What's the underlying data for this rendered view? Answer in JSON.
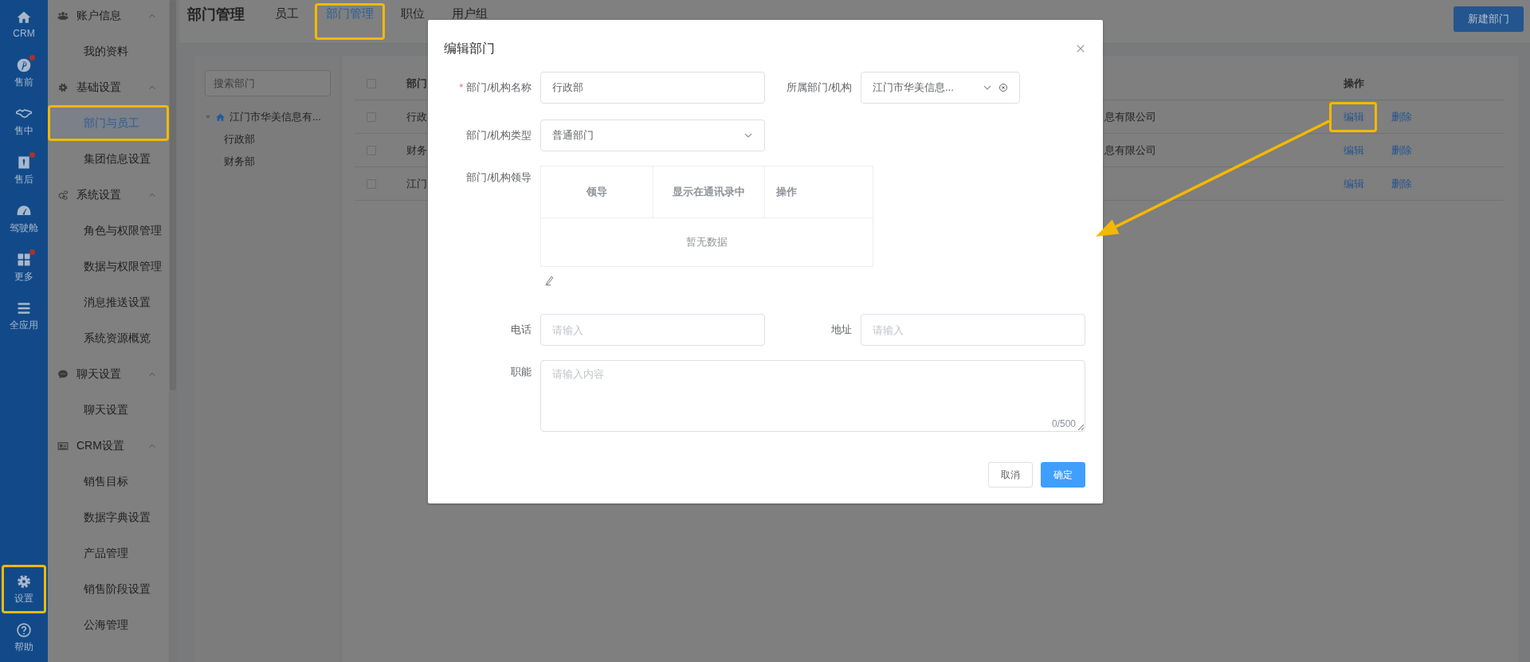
{
  "nav_rail": {
    "items": [
      {
        "label": "CRM",
        "has_dot": false,
        "highlighted": false
      },
      {
        "label": "售前",
        "has_dot": true,
        "highlighted": false
      },
      {
        "label": "售中",
        "has_dot": false,
        "highlighted": false
      },
      {
        "label": "售后",
        "has_dot": true,
        "highlighted": false
      },
      {
        "label": "驾驶舱",
        "has_dot": false,
        "highlighted": false
      },
      {
        "label": "更多",
        "has_dot": true,
        "highlighted": false
      },
      {
        "label": "全应用",
        "has_dot": false,
        "highlighted": false
      }
    ],
    "bottom_items": [
      {
        "label": "设置",
        "has_dot": false,
        "highlighted": true
      },
      {
        "label": "帮助",
        "has_dot": false,
        "highlighted": false
      }
    ]
  },
  "sidebar": {
    "groups": [
      {
        "title": "账户信息",
        "expanded": true,
        "items": [
          {
            "label": "我的资料",
            "selected": false,
            "highlighted": false
          }
        ]
      },
      {
        "title": "基础设置",
        "expanded": true,
        "items": [
          {
            "label": "部门与员工",
            "selected": true,
            "highlighted": true
          },
          {
            "label": "集团信息设置",
            "selected": false,
            "highlighted": false
          }
        ]
      },
      {
        "title": "系统设置",
        "expanded": true,
        "items": [
          {
            "label": "角色与权限管理",
            "selected": false,
            "highlighted": false
          },
          {
            "label": "数据与权限管理",
            "selected": false,
            "highlighted": false
          },
          {
            "label": "消息推送设置",
            "selected": false,
            "highlighted": false
          },
          {
            "label": "系统资源概览",
            "selected": false,
            "highlighted": false
          }
        ]
      },
      {
        "title": "聊天设置",
        "expanded": true,
        "items": [
          {
            "label": "聊天设置",
            "selected": false,
            "highlighted": false
          }
        ]
      },
      {
        "title": "CRM设置",
        "expanded": true,
        "items": [
          {
            "label": "销售目标",
            "selected": false,
            "highlighted": false
          },
          {
            "label": "数据字典设置",
            "selected": false,
            "highlighted": false
          },
          {
            "label": "产品管理",
            "selected": false,
            "highlighted": false
          },
          {
            "label": "销售阶段设置",
            "selected": false,
            "highlighted": false
          },
          {
            "label": "公海管理",
            "selected": false,
            "highlighted": false
          }
        ]
      }
    ]
  },
  "header": {
    "title": "部门管理",
    "tabs": [
      {
        "label": "员工",
        "selected": false,
        "highlighted": false
      },
      {
        "label": "部门管理",
        "selected": true,
        "highlighted": true
      },
      {
        "label": "职位",
        "selected": false,
        "highlighted": false
      },
      {
        "label": "用户组",
        "selected": false,
        "highlighted": false
      }
    ],
    "new_button": "新建部门"
  },
  "tree": {
    "search_placeholder": "搜索部门",
    "root": {
      "label": "江门市华美信息有...",
      "expanded": true,
      "children": [
        {
          "label": "行政部"
        },
        {
          "label": "财务部"
        }
      ]
    }
  },
  "table": {
    "all_checked": false,
    "header": {
      "name": "部门",
      "actions": "操作"
    },
    "rows": [
      {
        "checked": false,
        "name": "行政",
        "column_3": "息有限公司",
        "actions": [
          {
            "label": "编辑",
            "highlighted": true
          },
          {
            "label": "删除",
            "highlighted": false
          }
        ]
      },
      {
        "checked": false,
        "name": "财务",
        "column_3": "息有限公司",
        "actions": [
          {
            "label": "编辑",
            "highlighted": false
          },
          {
            "label": "删除",
            "highlighted": false
          }
        ]
      },
      {
        "checked": false,
        "name": "江门",
        "actions": [
          {
            "label": "编辑",
            "highlighted": false
          },
          {
            "label": "删除",
            "highlighted": false
          }
        ]
      }
    ]
  },
  "dialog": {
    "title": "编辑部门",
    "name_field": {
      "required_mark": "*",
      "label": "部门/机构名称",
      "value": "行政部"
    },
    "parent_field": {
      "label": "所属部门/机构",
      "value": "江门市华美信息..."
    },
    "type_field": {
      "label": "部门/机构类型",
      "value": "普通部门"
    },
    "leader_field": {
      "label": "部门/机构领导",
      "columns": [
        "领导",
        "显示在通讯录中",
        "操作"
      ],
      "empty_text": "暂无数据"
    },
    "phone_field": {
      "label": "电话",
      "placeholder": "请输入"
    },
    "address_field": {
      "label": "地址",
      "placeholder": "请输入"
    },
    "function_field": {
      "label": "职能",
      "placeholder": "请输入内容",
      "counter": "0/500"
    },
    "cancel_button": "取消",
    "confirm_button": "确定"
  }
}
